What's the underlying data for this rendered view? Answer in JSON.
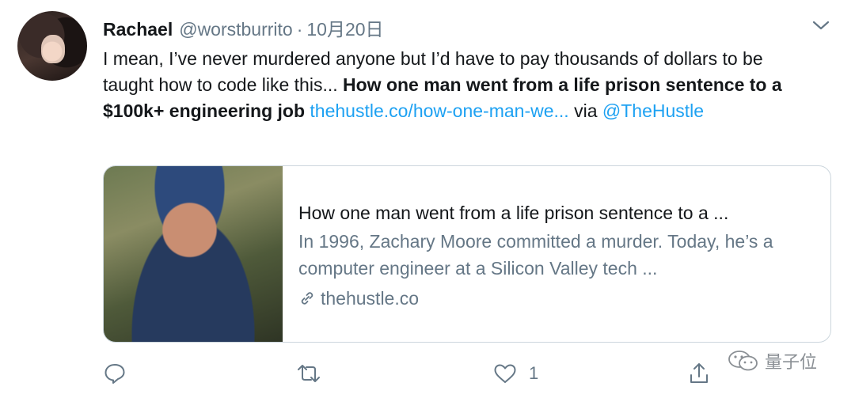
{
  "tweet": {
    "author_name": "Rachael",
    "author_handle": "@worstburrito",
    "separator": "·",
    "date": "10月20日",
    "text_plain": "I mean, I’ve never murdered anyone but I’d have to pay thousands of dollars to be taught how to code like this...",
    "text_bold": "How one man went from a life prison sentence to a $100k+ engineering job",
    "link_text": "thehustle.co/how-one-man-we...",
    "via_text": "via",
    "mention": "@TheHustle"
  },
  "card": {
    "title": "How one man went from a life prison sentence to a ...",
    "description": "In 1996, Zachary Moore committed a murder. Today, he’s a computer engineer at a Silicon Valley tech ...",
    "domain": "thehustle.co",
    "domain_icon": "link-icon"
  },
  "actions": {
    "reply_icon": "reply-icon",
    "retweet_icon": "retweet-icon",
    "like_icon": "heart-icon",
    "like_count": "1",
    "share_icon": "share-icon"
  },
  "watermark": {
    "text": "量子位",
    "icon": "wechat-icon"
  },
  "colors": {
    "link": "#1da1f2",
    "secondary_text": "#657786",
    "border": "#ccd6dd"
  }
}
